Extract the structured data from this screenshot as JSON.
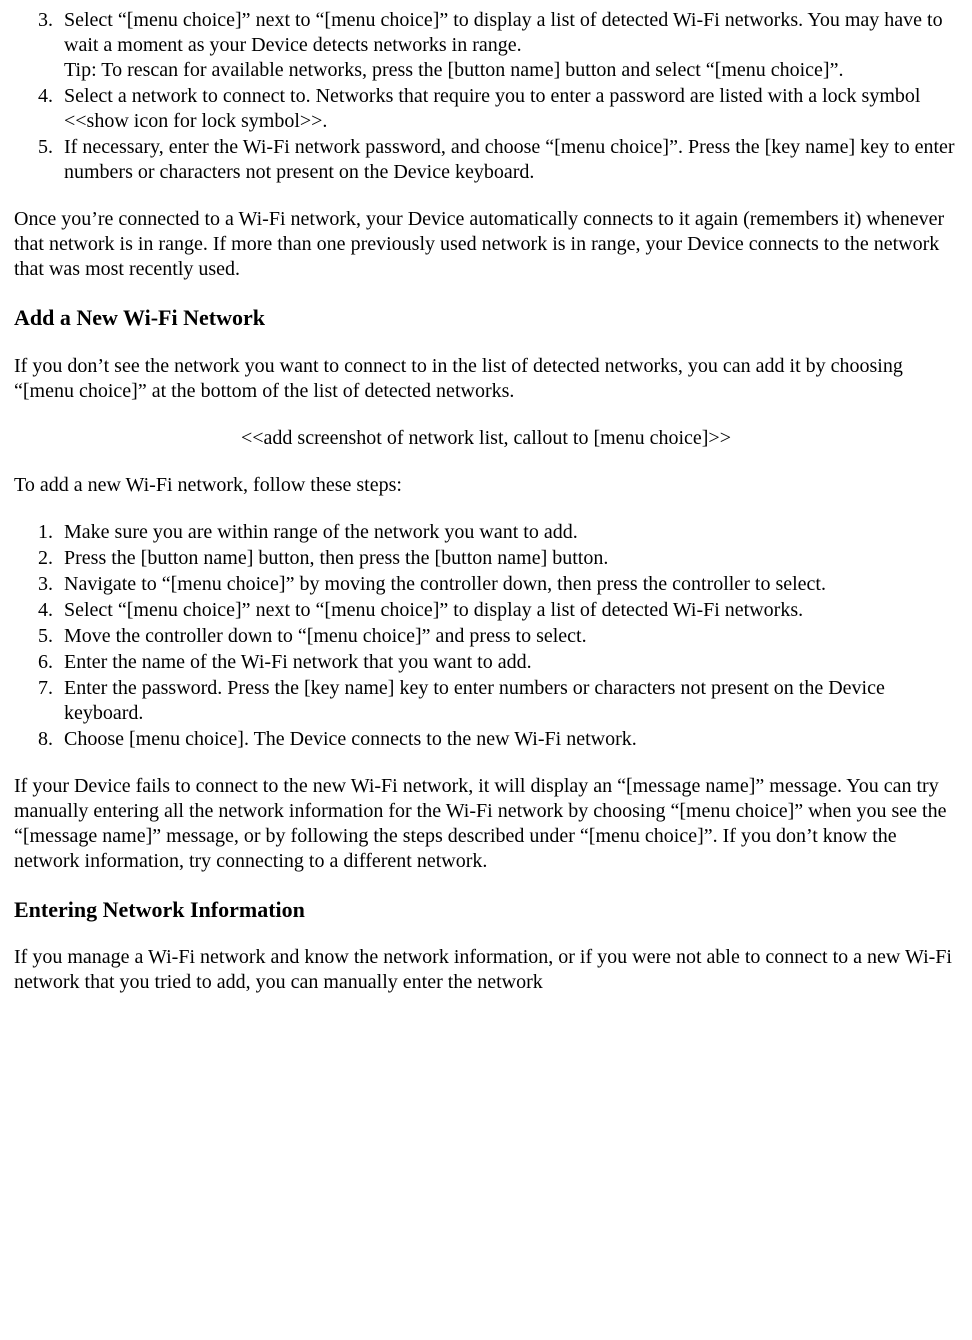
{
  "list1": {
    "start": 3,
    "items": [
      "Select “[menu choice]” next to “[menu choice]” to display a list of detected Wi-Fi networks. You may have to wait a moment as your Device detects networks in range.\nTip: To rescan for available networks, press the [button name] button and select “[menu choice]”.",
      "Select a network to connect to. Networks that require you to enter a password are listed with a lock symbol <<show icon for lock symbol>>.",
      "If necessary, enter the Wi-Fi network password, and choose “[menu choice]”.  Press the [key name] key to enter numbers or characters not present on the Device keyboard."
    ]
  },
  "para_connected": "Once you’re connected to a Wi-Fi network, your Device automatically connects to it again (remembers it) whenever that network is in range. If more than one previously used network is in range, your Device connects to the network that was most recently used.",
  "heading_add": "Add a New Wi-Fi Network",
  "para_add_intro": "If you don’t see the network you want to connect to in the list of detected networks, you can add it by choosing “[menu choice]” at the bottom of the list of detected networks.",
  "placeholder_screenshot": "<<add screenshot of network list, callout to [menu choice]>>",
  "para_add_steps_intro": "To add a new Wi-Fi network, follow these steps:",
  "list2": {
    "start": 1,
    "items": [
      "Make sure you are within range of the network you want to add.",
      "Press the [button name] button, then press the [button name] button.",
      "Navigate to “[menu choice]” by moving the controller down, then press the controller to select.",
      "Select “[menu choice]” next to “[menu choice]” to display a list of detected Wi-Fi networks.",
      "Move the controller down to “[menu choice]” and press to select.",
      "Enter the name of the Wi-Fi network that you want to add.",
      "Enter the password. Press the [key name] key to enter numbers or characters not present on the Device keyboard.",
      "Choose [menu choice]. The Device connects to the new Wi-Fi network."
    ]
  },
  "para_fail": "If your Device fails to connect to the new Wi-Fi network, it will display an “[message name]” message. You can try manually entering all the network information for the Wi-Fi network by choosing “[menu choice]” when you see the “[message name]” message, or by following the steps described under “[menu choice]”. If you don’t know the network information, try connecting to a different network.",
  "heading_netinfo": "Entering Network Information",
  "para_netinfo": "If you manage a Wi-Fi network and know the network information, or if you were not able to connect to a new Wi-Fi network that you tried to add, you can manually enter the network"
}
